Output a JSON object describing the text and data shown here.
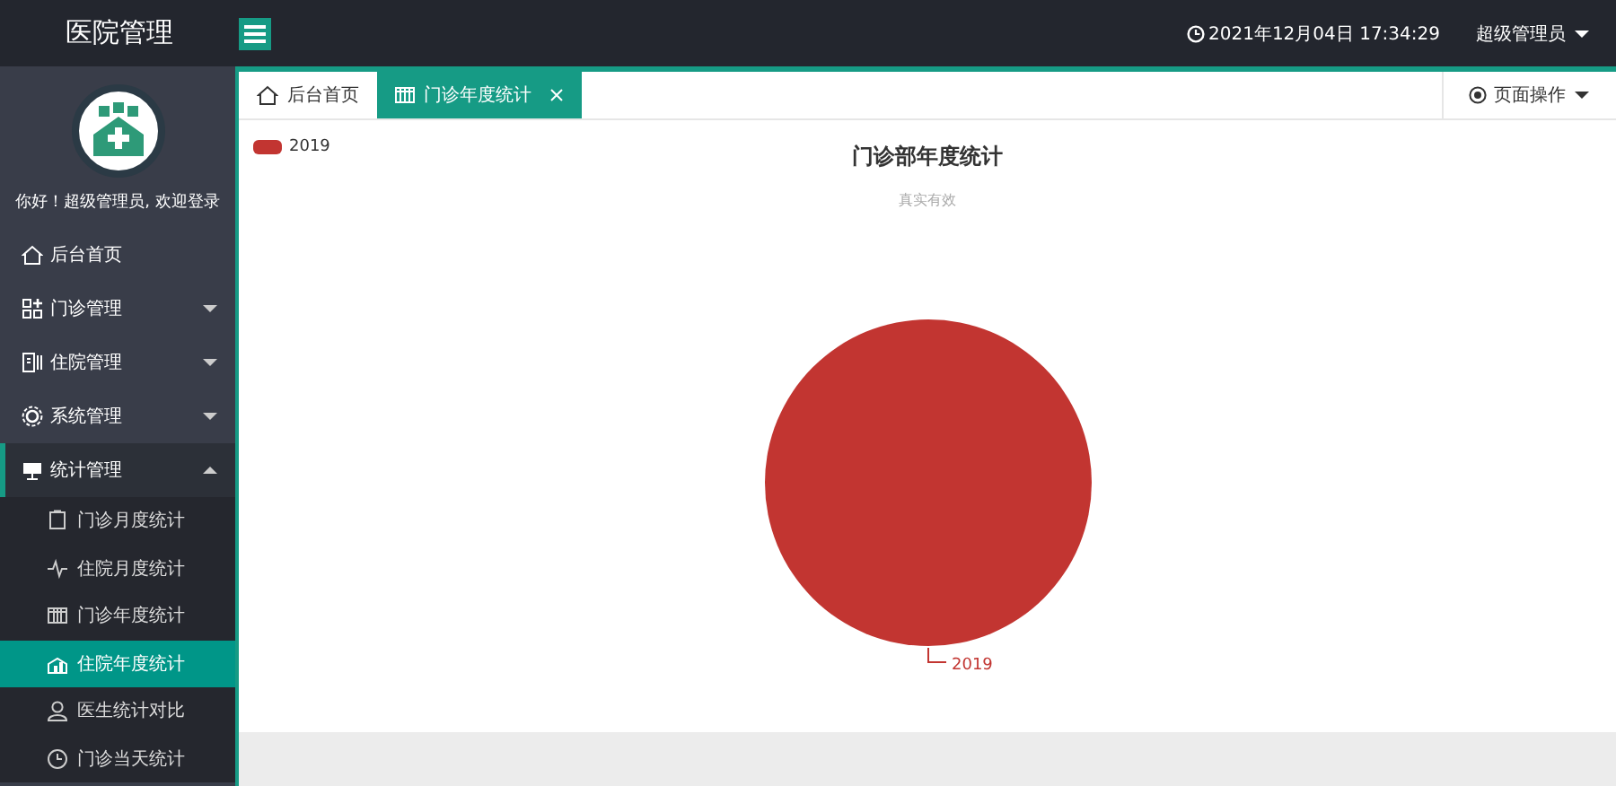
{
  "header": {
    "title": "医院管理",
    "datetime": "2021年12月04日 17:34:29",
    "user": "超级管理员"
  },
  "sidebar": {
    "greeting": "你好！超级管理员, 欢迎登录",
    "items": [
      {
        "label": "后台首页",
        "kind": "link"
      },
      {
        "label": "门诊管理",
        "kind": "group",
        "expanded": false
      },
      {
        "label": "住院管理",
        "kind": "group",
        "expanded": false
      },
      {
        "label": "系统管理",
        "kind": "group",
        "expanded": false
      },
      {
        "label": "统计管理",
        "kind": "group",
        "expanded": true,
        "children": [
          {
            "label": "门诊月度统计",
            "selected": false
          },
          {
            "label": "住院月度统计",
            "selected": false
          },
          {
            "label": "门诊年度统计",
            "selected": false
          },
          {
            "label": "住院年度统计",
            "selected": true
          },
          {
            "label": "医生统计对比",
            "selected": false
          },
          {
            "label": "门诊当天统计",
            "selected": false
          }
        ]
      }
    ]
  },
  "tabs": [
    {
      "label": "后台首页",
      "selected": false,
      "closable": false
    },
    {
      "label": "门诊年度统计",
      "selected": true,
      "closable": true
    }
  ],
  "page_actions": "页面操作",
  "chart": {
    "legend": [
      {
        "label": "2019",
        "color": "#c23531"
      }
    ],
    "subtitle": "真实有效",
    "chart_data": {
      "type": "pie",
      "title": "门诊部年度统计",
      "categories": [
        "2019"
      ]
    }
  }
}
